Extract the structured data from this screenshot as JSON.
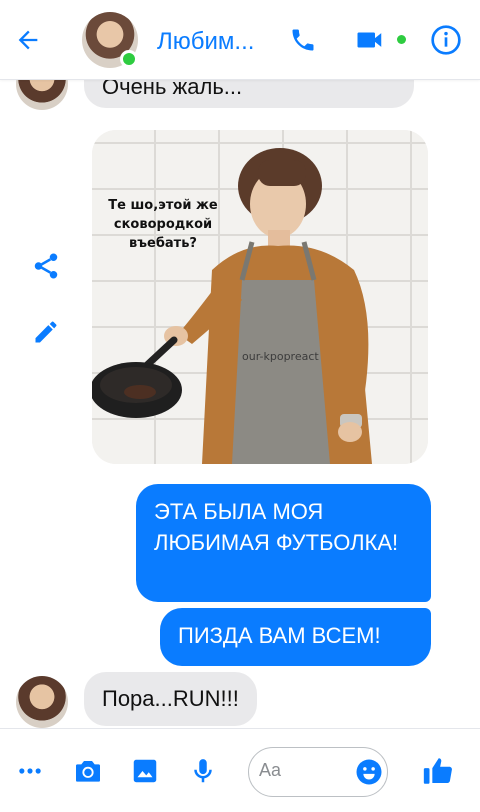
{
  "header": {
    "title": "Любим...",
    "back_icon": "arrow-left-icon",
    "call_icon": "phone-icon",
    "video_icon": "video-camera-icon",
    "info_icon": "info-icon",
    "accent": "#0a7cff",
    "online_color": "#2ecc40"
  },
  "messages": {
    "top_partial": "Очень жаль...",
    "meme_caption": "Те шо,этой же сковородкой въебать?",
    "meme_watermark": "our-kpopreact",
    "out_1": "ЭТА БЫЛА МОЯ ЛЮБИМАЯ ФУТБОЛКА!",
    "out_2": "ПИЗДА ВАМ ВСЕМ!",
    "in_last": "Пора...RUN!!!",
    "incoming_bg": "#e9e9eb",
    "outgoing_bg": "#0a7cff"
  },
  "side_actions": {
    "share_icon": "share-icon",
    "edit_icon": "pencil-icon"
  },
  "composer": {
    "placeholder": "Aa",
    "icons": [
      "more-dots-icon",
      "camera-icon",
      "image-icon",
      "microphone-icon",
      "emoji-icon",
      "thumbs-up-icon"
    ]
  }
}
